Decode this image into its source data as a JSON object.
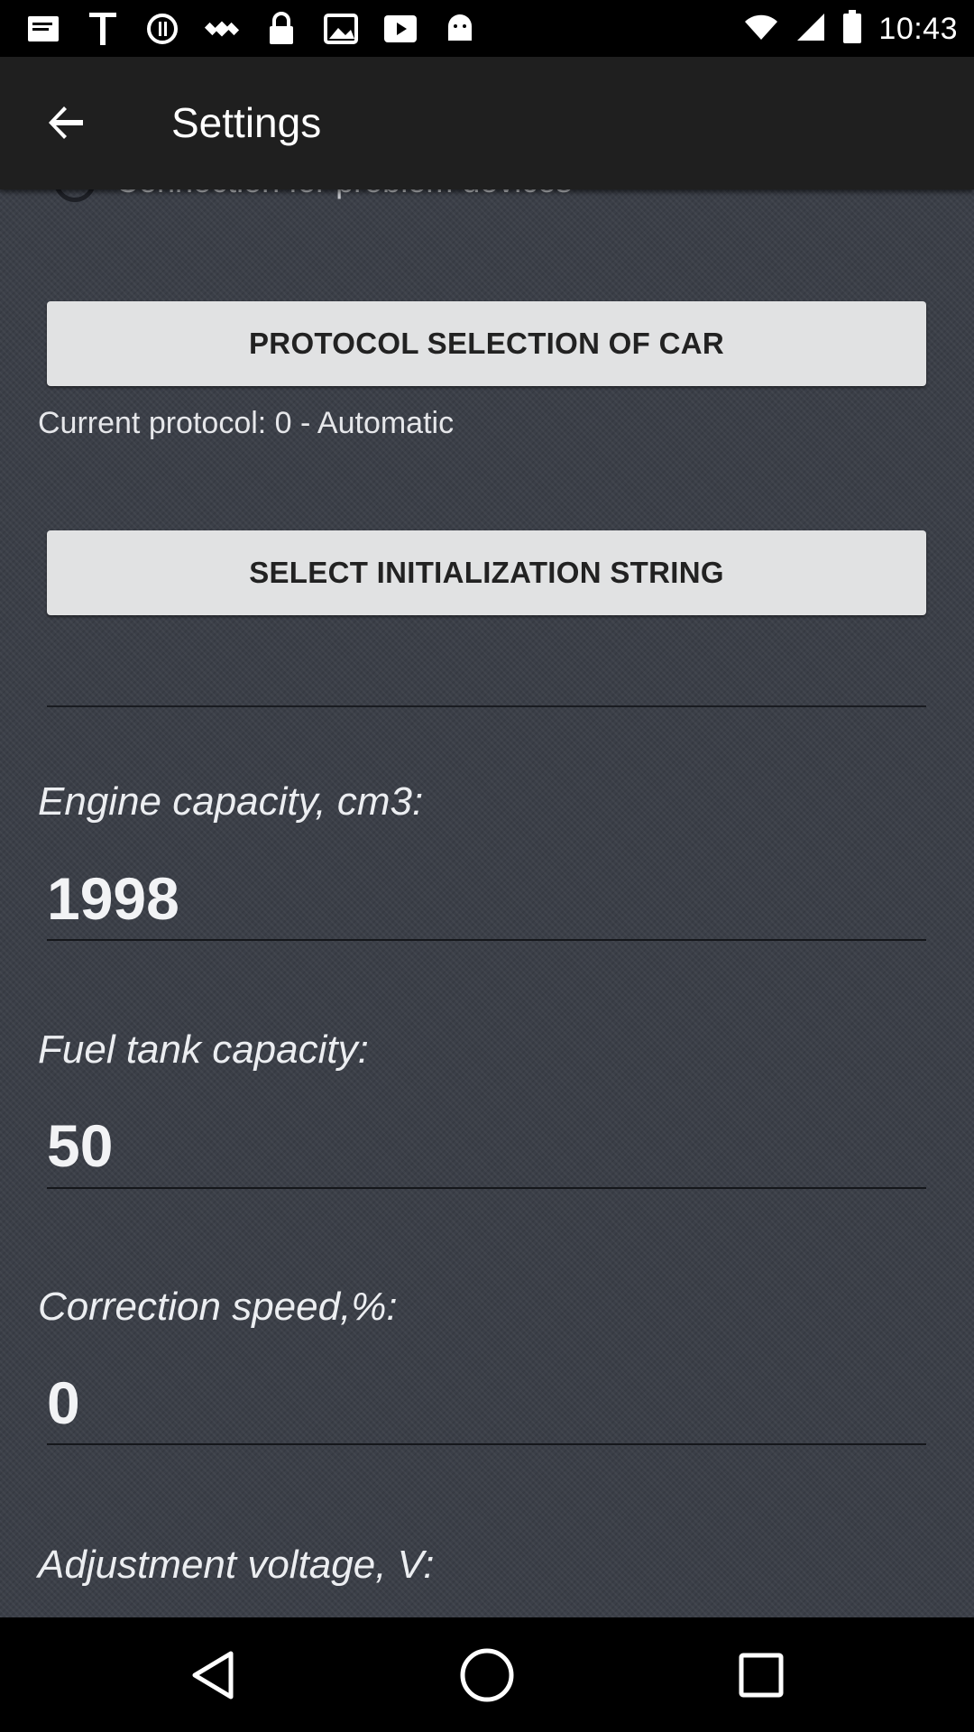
{
  "status_bar": {
    "time": "10:43",
    "icons": [
      "message-icon",
      "text-t-icon",
      "do-not-disturb-icon",
      "satellite-icon",
      "lock-icon",
      "photo-icon",
      "play-icon",
      "android-icon",
      "wifi-icon",
      "signal-icon",
      "battery-icon"
    ]
  },
  "app_bar": {
    "title": "Settings",
    "back_icon": "arrow-back-icon"
  },
  "settings": {
    "partial_option": "Connection for problem devices",
    "protocol_button": "PROTOCOL SELECTION OF CAR",
    "current_protocol": "Current protocol: 0 - Automatic",
    "init_button": "SELECT INITIALIZATION STRING",
    "fields": [
      {
        "label": "Engine capacity, cm3:",
        "value": "1998"
      },
      {
        "label": "Fuel tank capacity:",
        "value": "50"
      },
      {
        "label": "Correction speed,%:",
        "value": "0"
      },
      {
        "label": "Adjustment voltage, V:",
        "value": ""
      }
    ]
  },
  "nav_bar": {
    "back": "nav-back-icon",
    "home": "nav-home-icon",
    "recent": "nav-recent-icon"
  }
}
